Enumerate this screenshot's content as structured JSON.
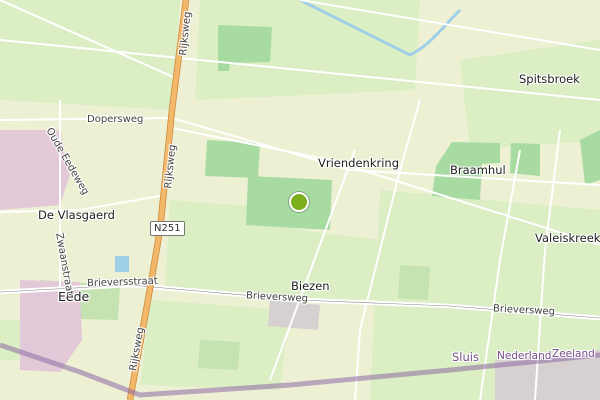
{
  "map": {
    "places": {
      "spitsbroek": "Spitsbroek",
      "vriendenkring": "Vriendenkring",
      "braamhul": "Braamhul",
      "de_vlasgaerd": "De Vlasgaerd",
      "valeiskreek": "Valeiskreek",
      "biezen": "Biezen",
      "eede": "Eede",
      "sluis": "Sluis"
    },
    "roads": {
      "rijksweg_top": "Rijksweg",
      "rijksweg_mid": "Rijksweg",
      "rijksweg_bottom": "Rijksweg",
      "dopersweg": "Dopersweg",
      "oude_eedeweg": "Oude Eedeweg",
      "zwaanstraat": "Zwaanstraat",
      "brieversstraat": "Brieversstraat",
      "brieversweg_mid": "Brieversweg",
      "brieversweg_right": "Brieversweg"
    },
    "shield_n251": "N251",
    "borders": {
      "nederland": "Nederland",
      "zeeland": "Zeeland"
    },
    "colors": {
      "background": "#eef0d4",
      "field_light": "#dbeec4",
      "forest": "#a8dba2",
      "road_major": "#f3b76a",
      "border": "#8e6aa4",
      "water": "#9fd0e8",
      "marker": "#7cad1a"
    },
    "marker_icon": "location-pin-icon"
  }
}
